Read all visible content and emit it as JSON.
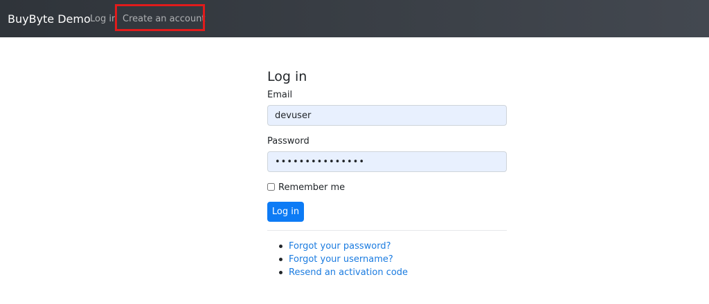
{
  "navbar": {
    "brand": "BuyByte Demo",
    "links": {
      "login": "Log in",
      "register": "Create an account"
    }
  },
  "form": {
    "title": "Log in",
    "email": {
      "label": "Email",
      "value": "devuser"
    },
    "password": {
      "label": "Password",
      "value": "•••••••••••••••"
    },
    "remember": {
      "label": "Remember me",
      "checked": false
    },
    "submit_label": "Log in"
  },
  "help_links": [
    "Forgot your password?",
    "Forgot your username?",
    "Resend an activation code"
  ],
  "colors": {
    "navbar": "#343a40",
    "primary": "#0d7bf5",
    "link": "#1a7be0",
    "highlight": "#e11b1b",
    "autofill": "#e8f0fe"
  }
}
